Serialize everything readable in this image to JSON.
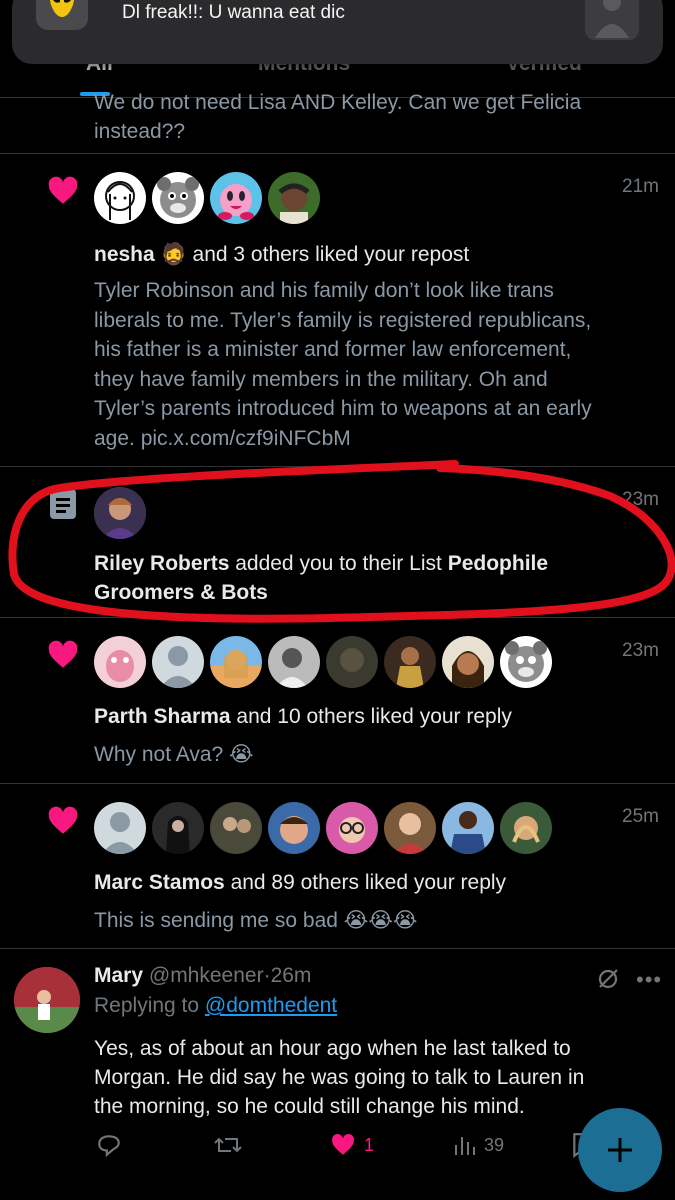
{
  "notification_banner": {
    "text": "Dl freak!!:  U wanna eat dic"
  },
  "tabs": [
    {
      "label": "All"
    },
    {
      "label": "Mentions"
    },
    {
      "label": "Verified"
    }
  ],
  "prev_snippet": {
    "line1": "We do not need Lisa AND Kelley. Can we get Felicia",
    "line2": "instead??"
  },
  "notifications": [
    {
      "type": "like",
      "time": "21m",
      "actor": "nesha",
      "emoji": "🧔",
      "action": "and 3 others liked your repost",
      "body_lines": [
        "Tyler Robinson and his family don’t look like trans",
        "liberals to me. Tyler’s family is registered republicans,",
        "his father is a minister and former law enforcement,",
        "they have family members in the military. Oh and",
        "Tyler’s parents introduced him to weapons at an early",
        "age. pic.x.com/czf9iNFCbM"
      ]
    },
    {
      "type": "list",
      "time": "23m",
      "actor": "Riley Roberts",
      "action": "added you to their List",
      "list_name_1": "Pedophile",
      "list_name_2": "Groomers & Bots"
    },
    {
      "type": "like",
      "time": "23m",
      "actor": "Parth Sharma",
      "action": "and 10 others liked your reply",
      "body": "Why not Ava? 😭"
    },
    {
      "type": "like",
      "time": "25m",
      "actor": "Marc Stamos",
      "action": "and 89 others liked your reply",
      "body": "This is sending me so bad 😭😭😭"
    }
  ],
  "reply": {
    "name": "Mary",
    "handle": "@mhkeener",
    "time": "26m",
    "replying_label": "Replying to",
    "replying_to": "@domthedent",
    "lines": [
      "Yes, as of about an hour ago when he last talked to",
      "Morgan. He did say he was going to talk to Lauren in",
      "the morning, so he could still change his mind."
    ],
    "likes": "1",
    "views": "39"
  },
  "colors": {
    "accent": "#1d9bf0",
    "heart": "#f91880",
    "annotation": "#e0101c"
  }
}
